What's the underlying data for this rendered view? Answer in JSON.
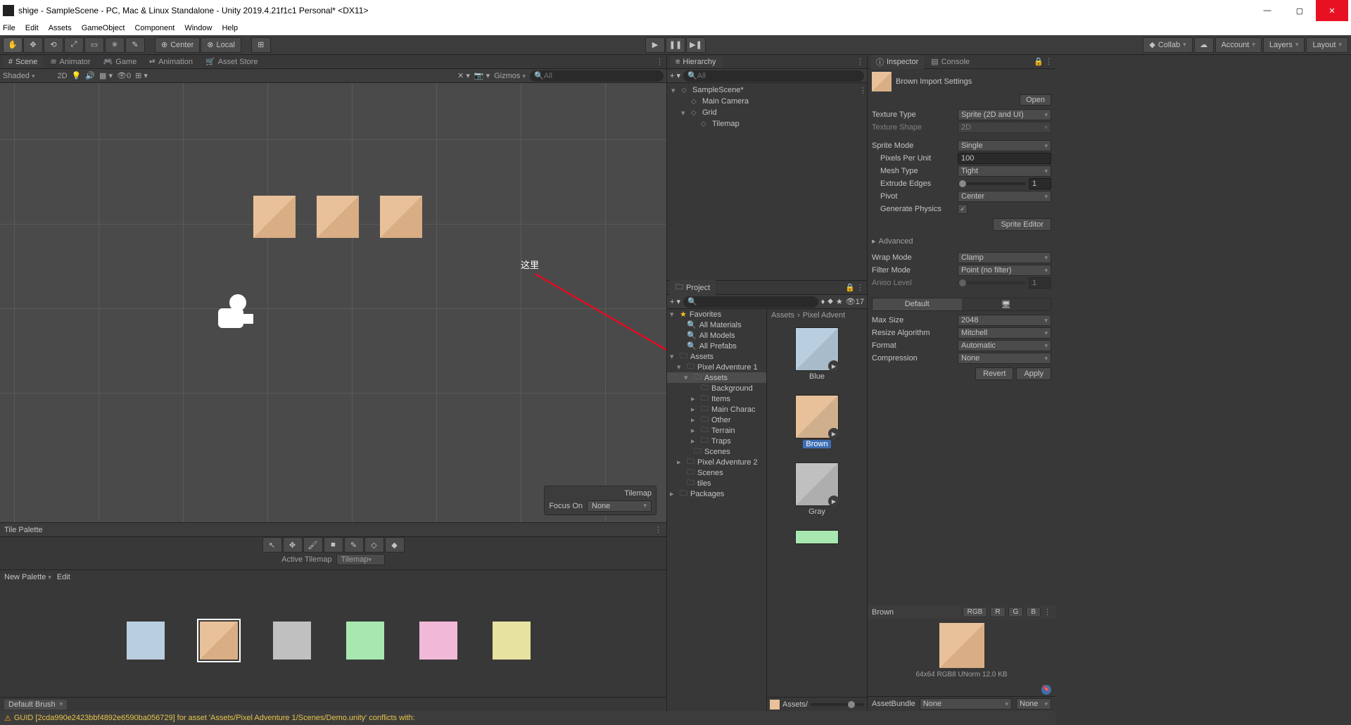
{
  "window": {
    "title": "shige - SampleScene - PC, Mac & Linux Standalone - Unity 2019.4.21f1c1 Personal* <DX11>"
  },
  "menubar": [
    "File",
    "Edit",
    "Assets",
    "GameObject",
    "Component",
    "Window",
    "Help"
  ],
  "toolbar": {
    "center": "Center",
    "local": "Local",
    "collab": "Collab",
    "account": "Account",
    "layers": "Layers",
    "layout": "Layout"
  },
  "scene": {
    "tabs": [
      "Scene",
      "Animator",
      "Game",
      "Animation",
      "Asset Store"
    ],
    "shading": "Shaded",
    "mode_2d": "2D",
    "gizmos": "Gizmos",
    "search_ph": "All",
    "annotation": "这里",
    "focus_title": "Tilemap",
    "focus_label": "Focus On",
    "focus_value": "None"
  },
  "tile_palette": {
    "title": "Tile Palette",
    "active_tilemap_label": "Active Tilemap",
    "active_tilemap_value": "Tilemap",
    "new_palette": "New Palette",
    "edit": "Edit",
    "default_brush": "Default Brush"
  },
  "hierarchy": {
    "title": "Hierarchy",
    "search_ph": "All",
    "items": [
      {
        "label": "SampleScene*",
        "indent": 0,
        "arrow": "▾",
        "icon": "scene"
      },
      {
        "label": "Main Camera",
        "indent": 1,
        "arrow": "",
        "icon": "cube"
      },
      {
        "label": "Grid",
        "indent": 1,
        "arrow": "▾",
        "icon": "cube"
      },
      {
        "label": "Tilemap",
        "indent": 2,
        "arrow": "",
        "icon": "cube"
      }
    ]
  },
  "project": {
    "title": "Project",
    "search_ph": "",
    "hidden_count": "17",
    "breadcrumb": [
      "Assets",
      "Pixel Advent"
    ],
    "tree": [
      {
        "label": "Favorites",
        "indent": 0,
        "arrow": "▾",
        "icon": "star"
      },
      {
        "label": "All Materials",
        "indent": 1,
        "arrow": "",
        "icon": "search"
      },
      {
        "label": "All Models",
        "indent": 1,
        "arrow": "",
        "icon": "search"
      },
      {
        "label": "All Prefabs",
        "indent": 1,
        "arrow": "",
        "icon": "search"
      },
      {
        "label": "Assets",
        "indent": 0,
        "arrow": "▾",
        "icon": "folder"
      },
      {
        "label": "Pixel Adventure 1",
        "indent": 1,
        "arrow": "▾",
        "icon": "folder"
      },
      {
        "label": "Assets",
        "indent": 2,
        "arrow": "▾",
        "icon": "folder",
        "sel": true
      },
      {
        "label": "Background",
        "indent": 3,
        "arrow": "",
        "icon": "folder"
      },
      {
        "label": "Items",
        "indent": 3,
        "arrow": "▸",
        "icon": "folder"
      },
      {
        "label": "Main Charac",
        "indent": 3,
        "arrow": "▸",
        "icon": "folder"
      },
      {
        "label": "Other",
        "indent": 3,
        "arrow": "▸",
        "icon": "folder"
      },
      {
        "label": "Terrain",
        "indent": 3,
        "arrow": "▸",
        "icon": "folder"
      },
      {
        "label": "Traps",
        "indent": 3,
        "arrow": "▸",
        "icon": "folder"
      },
      {
        "label": "Scenes",
        "indent": 2,
        "arrow": "",
        "icon": "folder"
      },
      {
        "label": "Pixel Adventure 2",
        "indent": 1,
        "arrow": "▸",
        "icon": "folder"
      },
      {
        "label": "Scenes",
        "indent": 1,
        "arrow": "",
        "icon": "folder"
      },
      {
        "label": "tiles",
        "indent": 1,
        "arrow": "",
        "icon": "folder"
      },
      {
        "label": "Packages",
        "indent": 0,
        "arrow": "▸",
        "icon": "folder"
      }
    ],
    "items": [
      {
        "label": "Blue",
        "color": "#b9cfe0",
        "sel": false
      },
      {
        "label": "Brown",
        "color": "#e8c19a",
        "sel": true
      },
      {
        "label": "Gray",
        "color": "#c0c0c0",
        "sel": false
      }
    ],
    "footer_path": "Assets/"
  },
  "inspector": {
    "tab_inspector": "Inspector",
    "tab_console": "Console",
    "title": "Brown Import Settings",
    "open_btn": "Open",
    "texture_type": {
      "label": "Texture Type",
      "value": "Sprite (2D and UI)"
    },
    "texture_shape": {
      "label": "Texture Shape",
      "value": "2D"
    },
    "sprite_mode": {
      "label": "Sprite Mode",
      "value": "Single"
    },
    "ppu": {
      "label": "Pixels Per Unit",
      "value": "100"
    },
    "mesh_type": {
      "label": "Mesh Type",
      "value": "Tight"
    },
    "extrude": {
      "label": "Extrude Edges",
      "value": "1"
    },
    "pivot": {
      "label": "Pivot",
      "value": "Center"
    },
    "gen_physics": {
      "label": "Generate Physics",
      "value": true
    },
    "sprite_editor_btn": "Sprite Editor",
    "advanced": "Advanced",
    "wrap_mode": {
      "label": "Wrap Mode",
      "value": "Clamp"
    },
    "filter_mode": {
      "label": "Filter Mode",
      "value": "Point (no filter)"
    },
    "aniso": {
      "label": "Aniso Level",
      "value": "1"
    },
    "default_tab": "Default",
    "max_size": {
      "label": "Max Size",
      "value": "2048"
    },
    "resize_algo": {
      "label": "Resize Algorithm",
      "value": "Mitchell"
    },
    "format": {
      "label": "Format",
      "value": "Automatic"
    },
    "compression": {
      "label": "Compression",
      "value": "None"
    },
    "revert_btn": "Revert",
    "apply_btn": "Apply",
    "preview_name": "Brown",
    "preview_channels": [
      "RGB",
      "R",
      "G",
      "B"
    ],
    "preview_info": "64x64  RGB8 UNorm  12.0 KB",
    "assetbundle_label": "AssetBundle",
    "assetbundle_value": "None",
    "assetbundle_variant": "None"
  },
  "statusbar": {
    "message": "GUID [2cda990e2423bbf4892e6590ba056729] for asset 'Assets/Pixel Adventure 1/Scenes/Demo.unity' conflicts with:"
  }
}
